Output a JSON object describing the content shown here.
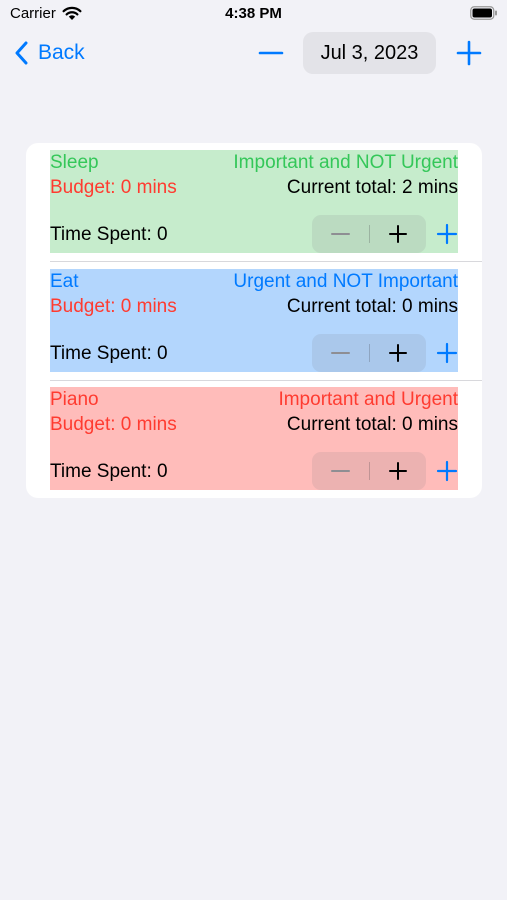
{
  "status": {
    "carrier": "Carrier",
    "time": "4:38 PM"
  },
  "nav": {
    "back_label": "Back",
    "date": "Jul 3, 2023"
  },
  "colors": {
    "accent": "#007aff",
    "green_bg": "#c6eccc",
    "green_text": "#34c759",
    "blue_bg": "#b3d6fd",
    "blue_text": "#007aff",
    "red_bg": "#ffbcba",
    "red_text": "#ff3b30",
    "budget_text": "#ff3b30"
  },
  "tasks": [
    {
      "name": "Sleep",
      "priority": "Important and NOT Urgent",
      "budget": "Budget: 0 mins",
      "total": "Current total: 2 mins",
      "spent": "Time Spent: 0",
      "theme": "green"
    },
    {
      "name": "Eat",
      "priority": "Urgent and NOT Important",
      "budget": "Budget: 0 mins",
      "total": "Current total: 0 mins",
      "spent": "Time Spent: 0",
      "theme": "blue"
    },
    {
      "name": "Piano",
      "priority": "Important and Urgent",
      "budget": "Budget: 0 mins",
      "total": "Current total: 0 mins",
      "spent": "Time Spent: 0",
      "theme": "red"
    }
  ]
}
